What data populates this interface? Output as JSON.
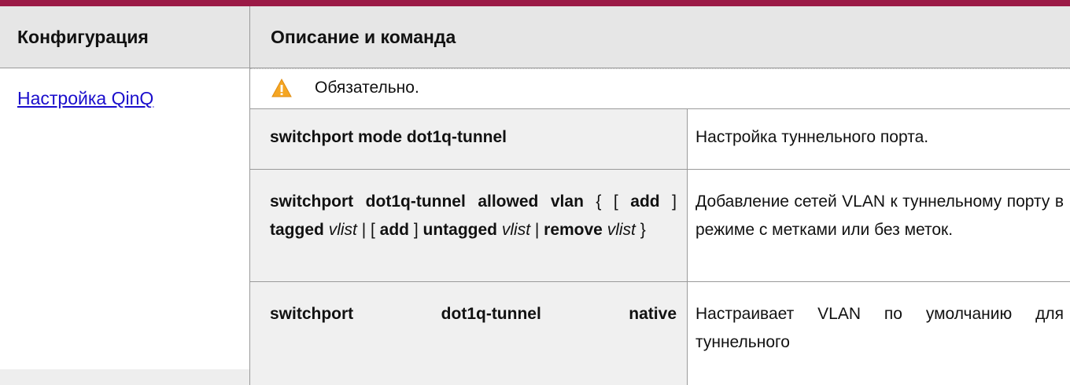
{
  "header": {
    "col_config": "Конфигурация",
    "col_desc": "Описание и команда"
  },
  "config": {
    "link_label": "Настройка QinQ"
  },
  "note": {
    "icon": "warning-triangle-icon",
    "text": "Обязательно."
  },
  "commands": [
    {
      "cmd": "switchport mode dot1q-tunnel",
      "desc": "Настройка туннельного порта."
    },
    {
      "cmd_parts": {
        "p1": "switchport dot1q-tunnel allowed vlan",
        "p2": " { [ ",
        "p3": "add",
        "p4": " ] ",
        "p5": "tagged",
        "p6": " ",
        "p7": "vlist",
        "p8": " | [ ",
        "p9": "add",
        "p10": " ] ",
        "p11": "untagged",
        "p12": " ",
        "p13": "vlist",
        "p14": " | ",
        "p15": "remove",
        "p16": " ",
        "p17": "vlist",
        "p18": " }"
      },
      "desc": "Добавление сетей VLAN к туннельному порту в режиме с метками или без меток."
    },
    {
      "cmd": "switchport dot1q-tunnel native",
      "desc": "Настраивает VLAN по умолчанию для туннельного"
    }
  ],
  "colors": {
    "accent_rule": "#9b1a46",
    "header_bg": "#e6e6e6",
    "cmd_bg": "#f0f0f0",
    "link": "#1a0dcc",
    "warning": "#f5a623"
  }
}
